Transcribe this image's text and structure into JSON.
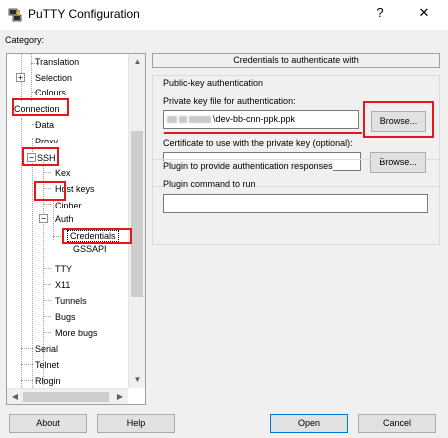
{
  "window": {
    "title": "PuTTY Configuration",
    "help_glyph": "?",
    "close_glyph": "✕",
    "icon": "putty-app-icon"
  },
  "category": {
    "label": "Category:",
    "items": {
      "translation": "Translation",
      "selection": "Selection",
      "colours": "Colours",
      "connection": "Connection",
      "data": "Data",
      "proxy": "Proxy",
      "ssh": "SSH",
      "kex": "Kex",
      "host_keys": "Host keys",
      "cipher": "Cipher",
      "auth": "Auth",
      "credentials": "Credentials",
      "gssapi": "GSSAPI",
      "tty": "TTY",
      "x11": "X11",
      "tunnels": "Tunnels",
      "bugs": "Bugs",
      "more_bugs": "More bugs",
      "serial": "Serial",
      "telnet": "Telnet",
      "rlogin": "Rlogin"
    },
    "expander_plus": "+",
    "expander_minus": "−"
  },
  "panel": {
    "header": "Credentials to authenticate with",
    "pubkey_group_label": "Public-key authentication",
    "private_key_label": "Private key file for authentication:",
    "private_key_value": "\\dev-bb-cnn-ppk.ppk",
    "browse_label": "Browse...",
    "certificate_label": "Certificate to use with the private key (optional):",
    "certificate_value": "",
    "browse2_label": "Browse...",
    "plugin_group_label": "Plugin to provide authentication responses",
    "plugin_command_label": "Plugin command to run",
    "plugin_command_value": ""
  },
  "footer": {
    "about": "About",
    "help": "Help",
    "open": "Open",
    "cancel": "Cancel"
  },
  "colors": {
    "highlight_red": "#e8151b",
    "default_button_border": "#0078d7"
  }
}
